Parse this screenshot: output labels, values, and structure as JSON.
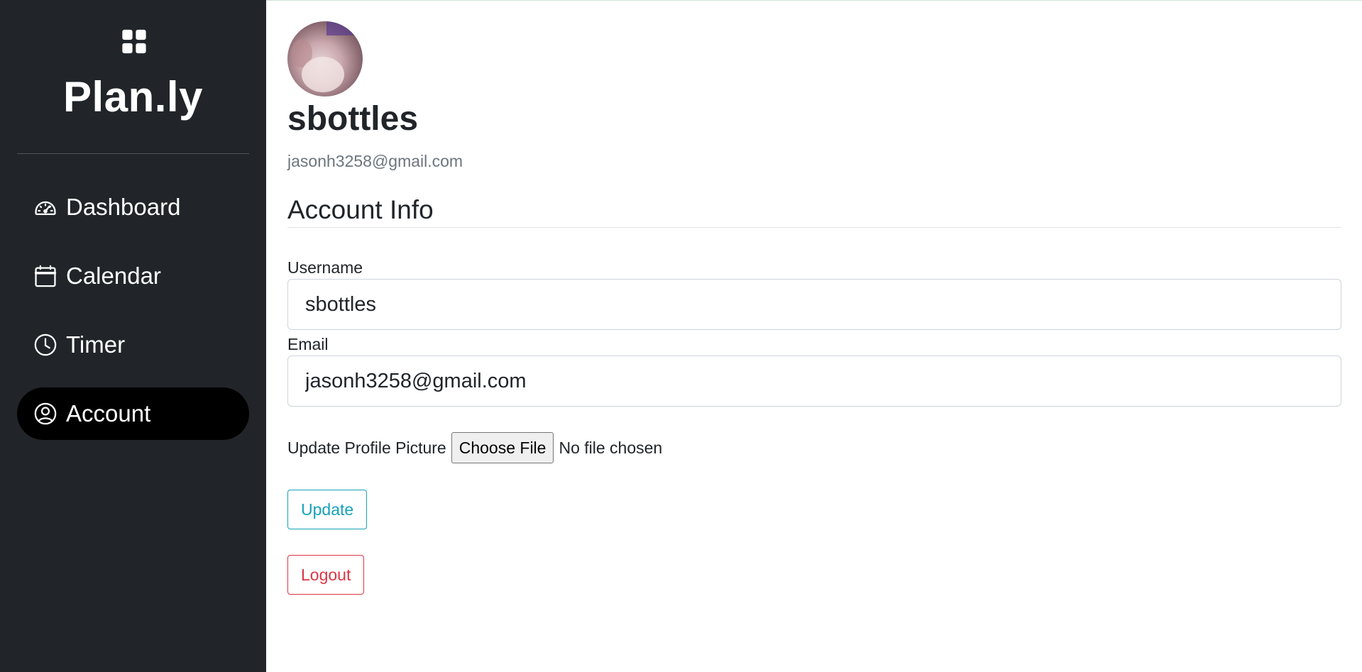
{
  "brand": {
    "title": "Plan.ly",
    "icon": "grid-icon"
  },
  "sidebar": {
    "items": [
      {
        "label": "Dashboard",
        "icon": "speedometer-icon",
        "active": false
      },
      {
        "label": "Calendar",
        "icon": "calendar-icon",
        "active": false
      },
      {
        "label": "Timer",
        "icon": "clock-icon",
        "active": false
      },
      {
        "label": "Account",
        "icon": "user-circle-icon",
        "active": true
      }
    ]
  },
  "profile": {
    "username": "sbottles",
    "email": "jasonh3258@gmail.com"
  },
  "account_info": {
    "title": "Account Info",
    "username_label": "Username",
    "username_value": "sbottles",
    "email_label": "Email",
    "email_value": "jasonh3258@gmail.com",
    "upload_label": "Update Profile Picture",
    "choose_file_label": "Choose File",
    "file_status": "No file chosen",
    "update_label": "Update",
    "logout_label": "Logout"
  },
  "colors": {
    "sidebar_bg": "#212529",
    "active_item_bg": "#000000",
    "info": "#17a2b8",
    "danger": "#dc3545"
  }
}
